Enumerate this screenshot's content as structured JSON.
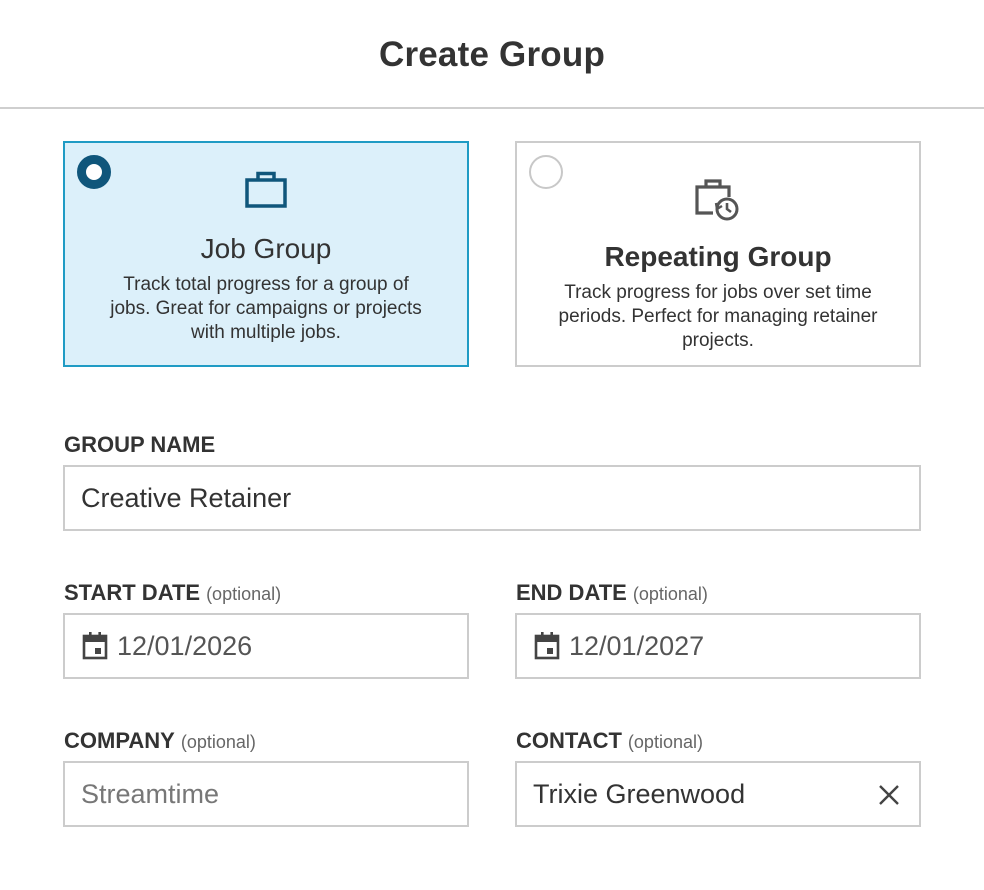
{
  "header": {
    "title": "Create Group"
  },
  "group_types": [
    {
      "title": "Job Group",
      "description": "Track total progress for a group of jobs. Great for campaigns or projects with multiple jobs.",
      "selected": true,
      "icon": "briefcase-icon"
    },
    {
      "title": "Repeating Group",
      "description": "Track progress for jobs over set time periods. Perfect for managing retainer projects.",
      "selected": false,
      "icon": "briefcase-clock-icon"
    }
  ],
  "form": {
    "group_name": {
      "label": "GROUP NAME",
      "value": "Creative Retainer"
    },
    "start_date": {
      "label": "START DATE",
      "optional": "(optional)",
      "value": "12/01/2026",
      "icon": "calendar-icon"
    },
    "end_date": {
      "label": "END DATE",
      "optional": "(optional)",
      "value": "12/01/2027",
      "icon": "calendar-icon"
    },
    "company": {
      "label": "COMPANY",
      "optional": "(optional)",
      "placeholder": "Streamtime"
    },
    "contact": {
      "label": "CONTACT",
      "optional": "(optional)",
      "value": "Trixie Greenwood",
      "clear_icon": "close-icon"
    }
  },
  "colors": {
    "selected_bg": "#dcf0fa",
    "selected_border": "#1f9bc4",
    "radio_selected": "#0f567b",
    "icon_blue": "#0f567b",
    "icon_gray": "#555555"
  }
}
